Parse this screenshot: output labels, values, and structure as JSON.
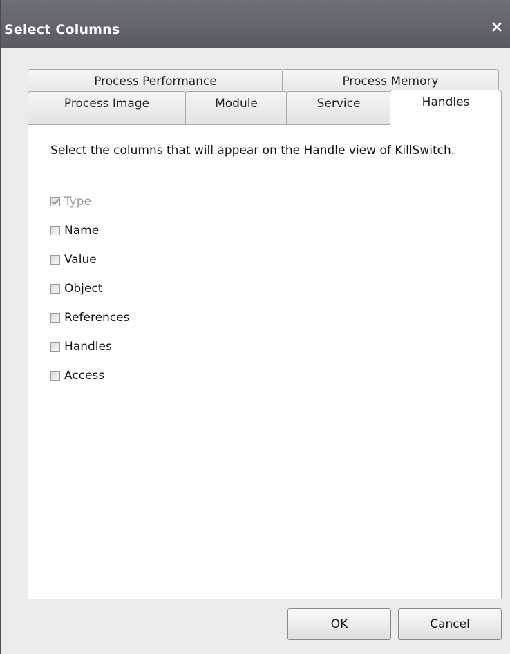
{
  "dialog": {
    "title": "Select Columns",
    "close_icon": "close-icon"
  },
  "tabs": {
    "row_back": [
      {
        "label": "Process Performance"
      },
      {
        "label": "Process Memory"
      }
    ],
    "row_front": [
      {
        "label": "Process Image"
      },
      {
        "label": "Module"
      },
      {
        "label": "Service"
      },
      {
        "label": "Handles",
        "active": true
      }
    ]
  },
  "panel": {
    "description": "Select the columns that will appear on the Handle view of KillSwitch.",
    "columns": [
      {
        "label": "Type",
        "checked": true,
        "disabled": true
      },
      {
        "label": "Name",
        "checked": false
      },
      {
        "label": "Value",
        "checked": false
      },
      {
        "label": "Object",
        "checked": false
      },
      {
        "label": "References",
        "checked": false
      },
      {
        "label": "Handles",
        "checked": false
      },
      {
        "label": "Access",
        "checked": false
      }
    ]
  },
  "buttons": {
    "ok_label": "OK",
    "cancel_label": "Cancel"
  },
  "colors": {
    "titlebar": "#5f5f68",
    "dialog_bg": "#ececec",
    "panel_bg": "#ffffff",
    "disabled_text": "#9a9a9a"
  }
}
